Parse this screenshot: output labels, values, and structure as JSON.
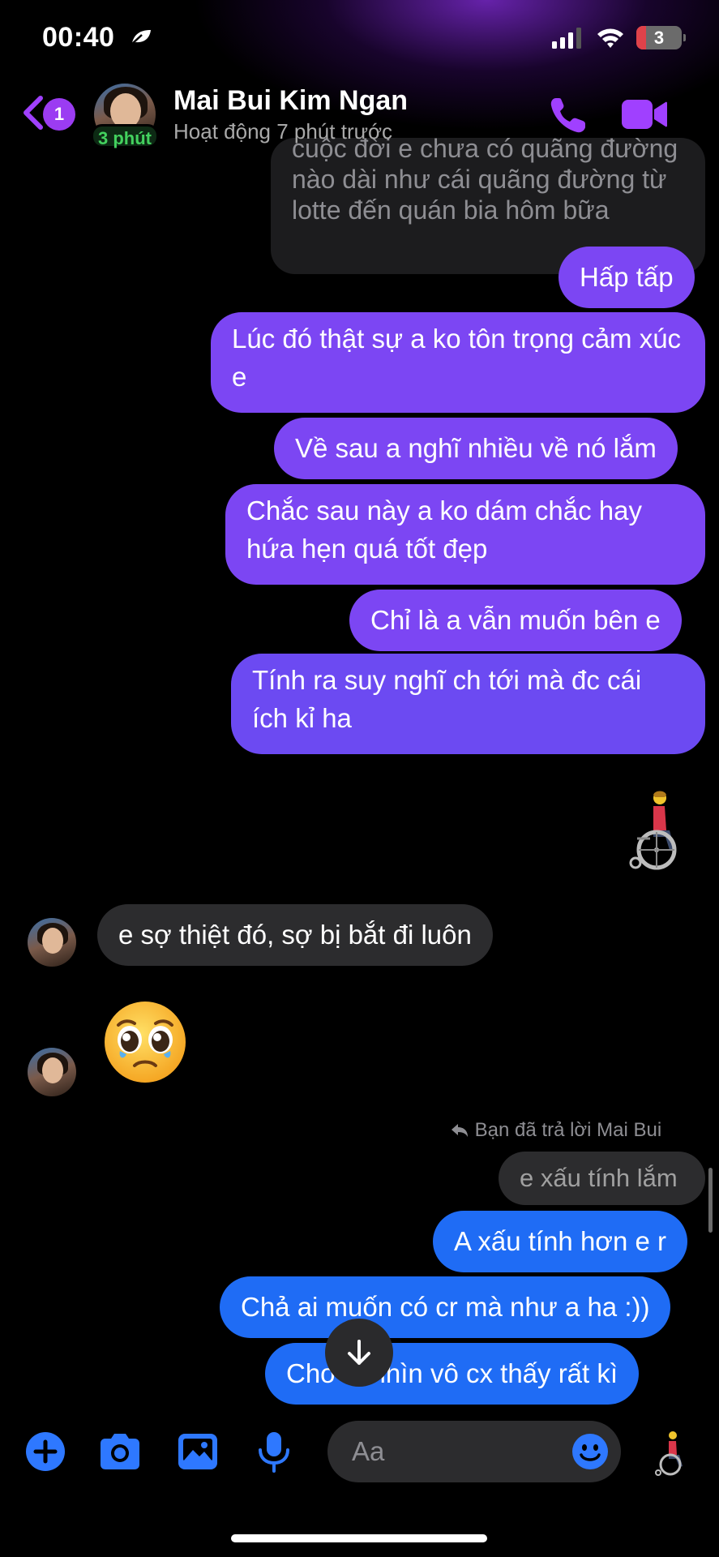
{
  "status_bar": {
    "time": "00:40",
    "battery": "3",
    "icons": [
      "leaf-icon",
      "signal-icon",
      "wifi-icon",
      "battery-icon"
    ]
  },
  "header": {
    "unread_count": "1",
    "contact_name": "Mai Bui Kim Ngan",
    "contact_status": "Hoạt động 7 phút trước",
    "avatar_badge": "3 phút",
    "icons": [
      "back-chevron-icon",
      "phone-call-icon",
      "video-call-icon"
    ]
  },
  "messages": {
    "quoted_partial": [
      "cuộc đời e chưa có quãng đường",
      "nào dài như cái quãng đường từ",
      "lotte đến quán bia hôm bữa"
    ],
    "m1": "Hấp tấp",
    "m2": "Lúc đó thật sự a ko tôn trọng cảm xúc e",
    "m3": "Về sau a nghĩ nhiều về nó lắm",
    "m4": "Chắc sau này a ko dám chắc hay hứa hẹn quá tốt đẹp",
    "m5": "Chỉ là a vẫn muốn bên e",
    "m6": "Tính ra suy nghĩ ch tới mà đc cái ích kỉ ha",
    "sent_sticker": "person-in-wheelchair-emoji",
    "m7": "e sợ thiệt đó, sợ bị bắt đi luôn",
    "received_emoji": "pleading-face-emoji",
    "reply_note": "Bạn đã trả lời Mai Bui",
    "reply_quote": "e xấu tính lắm",
    "m8": "A xấu tính hơn e r",
    "m9": "Chả ai muốn có cr mà như a ha :))",
    "m10": "Cho ai nhìn vô cx thấy rất kì"
  },
  "composer": {
    "placeholder": "Aa",
    "tools": [
      "plus-icon",
      "camera-icon",
      "gallery-icon",
      "microphone-icon",
      "emoji-smile-icon",
      "wheelchair-like-icon"
    ]
  },
  "colors": {
    "purple_bubble": "#7c46f3",
    "blue_bubble": "#1f6cf5",
    "gray_bubble": "#2c2c2e",
    "accent_purple": "#a040ff",
    "accent_blue": "#2e78ff",
    "active_green": "#43d15e"
  }
}
